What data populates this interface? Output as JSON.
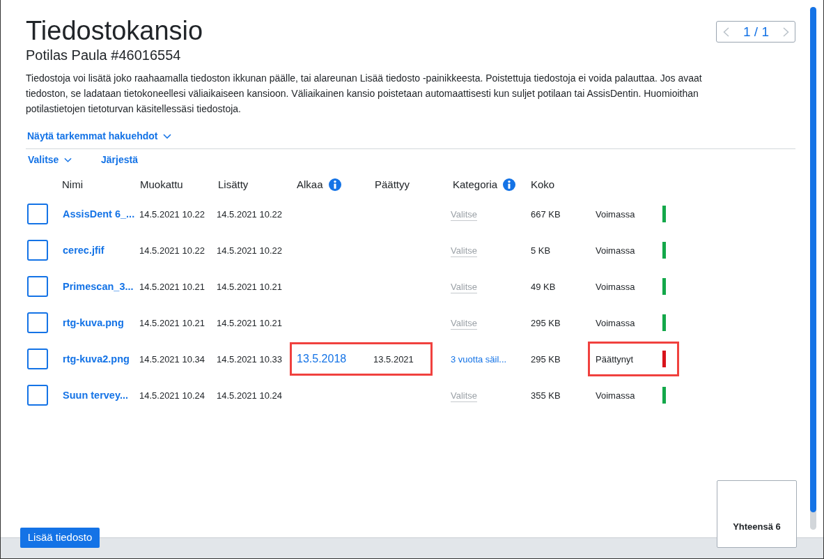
{
  "header": {
    "title": "Tiedostokansio",
    "subtitle": "Potilas Paula #46016554",
    "pager": {
      "text": "1 / 1",
      "prev_disabled": true,
      "next_disabled": true
    }
  },
  "description": "Tiedostoja voi lisätä joko raahaamalla tiedoston ikkunan päälle, tai alareunan Lisää tiedosto -painikkeesta. Poistettuja tiedostoja ei voida palauttaa. Jos avaat tiedoston, se ladataan tietokoneellesi väliaikaiseen kansioon. Väliaikainen kansio poistetaan automaattisesti kun suljet potilaan tai AssisDentin. Huomioithan potilastietojen tietoturvan käsitellessäsi tiedostoja.",
  "filters_toggle": {
    "label": "Näytä tarkemmat hakuehdot",
    "expanded": false
  },
  "toolbar": {
    "select_menu": "Valitse",
    "sort": "Järjestä"
  },
  "table": {
    "columns": [
      {
        "label": "Nimi",
        "info": false
      },
      {
        "label": "Muokattu",
        "info": false
      },
      {
        "label": "Lisätty",
        "info": false
      },
      {
        "label": "Alkaa",
        "info": true
      },
      {
        "label": "Päättyy",
        "info": false
      },
      {
        "label": "Kategoria",
        "info": true
      },
      {
        "label": "Koko",
        "info": false
      }
    ],
    "rows": [
      {
        "checked": false,
        "name": "AssisDent 6_...",
        "modified": "14.5.2021 10.22",
        "added": "14.5.2021 10.22",
        "category": "Valitse",
        "category_set": false,
        "size": "667 KB",
        "status": "Voimassa",
        "color": "#13a84a",
        "dates_highlighted": false,
        "status_highlighted": false
      },
      {
        "checked": false,
        "name": "cerec.jfif",
        "modified": "14.5.2021 10.22",
        "added": "14.5.2021 10.22",
        "category": "Valitse",
        "category_set": false,
        "size": "5 KB",
        "status": "Voimassa",
        "color": "#13a84a",
        "dates_highlighted": false,
        "status_highlighted": false
      },
      {
        "checked": false,
        "name": "Primescan_3...",
        "modified": "14.5.2021 10.21",
        "added": "14.5.2021 10.21",
        "category": "Valitse",
        "category_set": false,
        "size": "49 KB",
        "status": "Voimassa",
        "color": "#13a84a",
        "dates_highlighted": false,
        "status_highlighted": false
      },
      {
        "checked": false,
        "name": "rtg-kuva.png",
        "modified": "14.5.2021 10.21",
        "added": "14.5.2021 10.21",
        "category": "Valitse",
        "category_set": false,
        "size": "295 KB",
        "status": "Voimassa",
        "color": "#13a84a",
        "dates_highlighted": false,
        "status_highlighted": false
      },
      {
        "checked": false,
        "name": "rtg-kuva2.png",
        "modified": "14.5.2021 10.34",
        "added": "14.5.2021 10.33",
        "start": "13.5.2018",
        "end": "13.5.2021",
        "category": "3 vuotta säil...",
        "category_set": true,
        "size": "295 KB",
        "status": "Päättynyt",
        "color": "#d8141c",
        "dates_highlighted": true,
        "status_highlighted": true
      },
      {
        "checked": false,
        "name": "Suun tervey...",
        "modified": "14.5.2021 10.24",
        "added": "14.5.2021 10.24",
        "category": "Valitse",
        "category_set": false,
        "size": "355 KB",
        "status": "Voimassa",
        "color": "#13a84a",
        "dates_highlighted": false,
        "status_highlighted": false
      }
    ]
  },
  "footer": {
    "add_button": "Lisää tiedosto",
    "total": "Yhteensä 6"
  }
}
